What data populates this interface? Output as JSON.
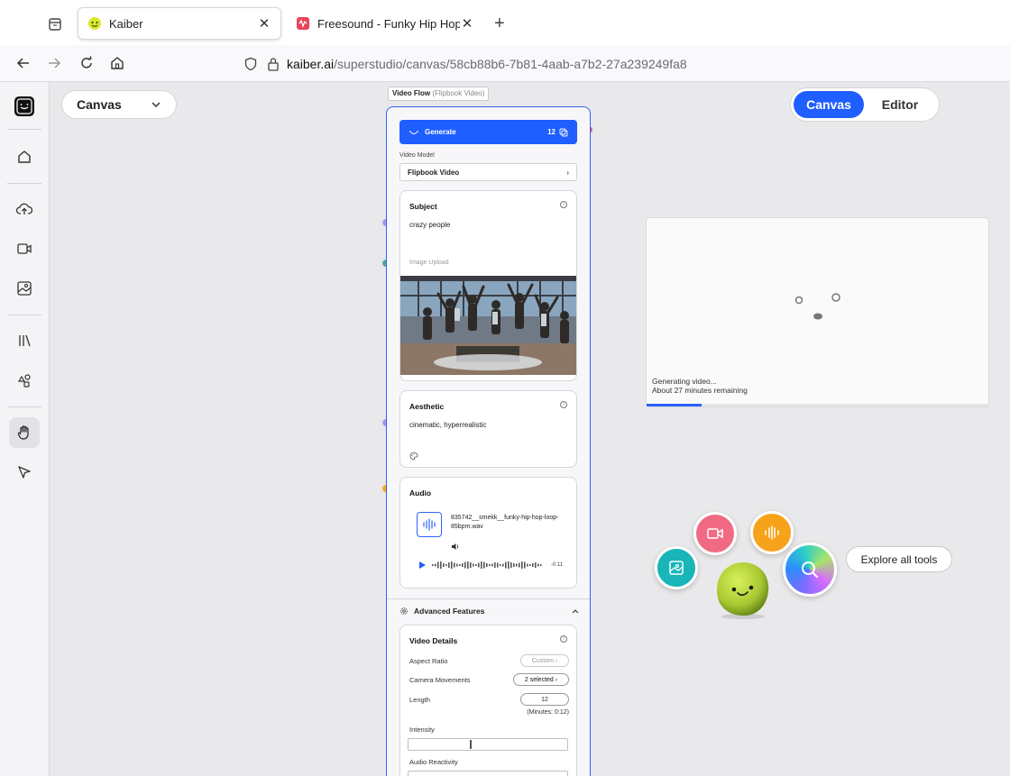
{
  "browser": {
    "tabs": [
      {
        "title": "Kaiber",
        "active": true
      },
      {
        "title": "Freesound - Funky Hip Hop Loo",
        "active": false
      }
    ],
    "url_host": "kaiber.ai",
    "url_path": "/superstudio/canvas/58cb88b6-7b81-4aab-a7b2-27a239249fa8"
  },
  "toolbar": {
    "canvas_dropdown": "Canvas",
    "mode_canvas": "Canvas",
    "mode_editor": "Editor"
  },
  "flow": {
    "label": "Video Flow",
    "label_sub": "(Flipbook Video)",
    "generate_label": "Generate",
    "generate_credits": "12",
    "video_model_label": "Video Model",
    "video_model_value": "Flipbook Video",
    "subject": {
      "title": "Subject",
      "text": "crazy people",
      "image_upload_label": "Image Upload"
    },
    "aesthetic": {
      "title": "Aesthetic",
      "text": "cinematic, hyperrealistic"
    },
    "audio": {
      "title": "Audio",
      "file_name": "835742__smekk__funky-hip-hop-loop-85bpm.wav",
      "time": "-0:11"
    },
    "advanced_label": "Advanced Features",
    "video_details": {
      "title": "Video Details",
      "aspect_ratio_label": "Aspect Ratio",
      "aspect_ratio_value": "Custom",
      "camera_label": "Camera Movements",
      "camera_value": "2 selected",
      "length_label": "Length",
      "length_value": "12",
      "length_minutes": "(Minutes: 0:12)",
      "intensity_label": "Intensity",
      "audio_reactivity_label": "Audio Reactivity"
    }
  },
  "preview": {
    "status": "Generating video...",
    "remaining": "About 27 minutes remaining",
    "progress": 0.16
  },
  "tools": {
    "explore_label": "Explore all tools"
  },
  "colors": {
    "accent": "#1f5eff",
    "port_red": "#e8546c",
    "port_purple": "#b28cf0",
    "port_teal": "#4fa5a0",
    "port_orange": "#f5a623",
    "orb_pink": "#f06a84",
    "orb_orange": "#f7a21b",
    "orb_teal": "#19b5b8"
  }
}
